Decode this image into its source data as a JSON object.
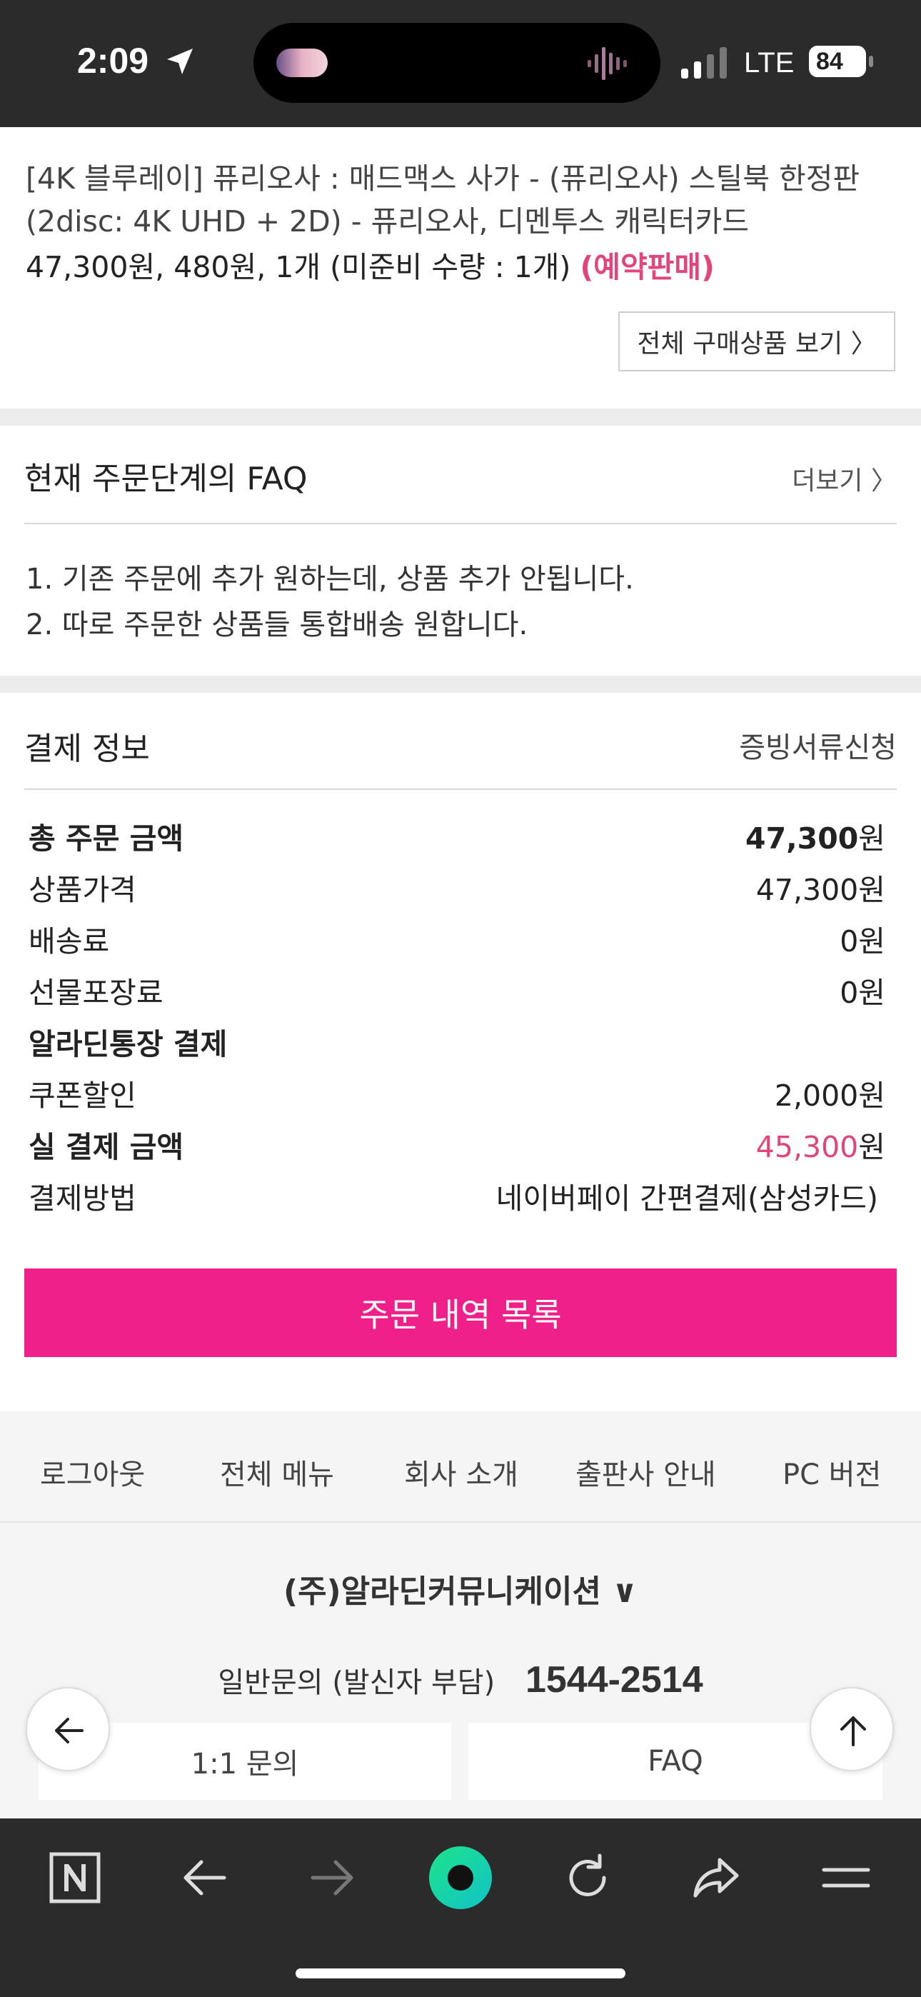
{
  "status_bar": {
    "time": "2:09",
    "network": "LTE",
    "battery": "84"
  },
  "product": {
    "title": "[4K 블루레이] 퓨리오사 : 매드맥스 사가 - (퓨리오사) 스틸북 한정판 (2disc: 4K UHD + 2D) - 퓨리오사, 디멘투스 캐릭터카드",
    "price_line": "47,300원, 480원, 1개 (미준비 수량 : 1개)",
    "preorder": "(예약판매)",
    "view_all_button": "전체 구매상품 보기 〉"
  },
  "faq": {
    "heading": "현재 주문단계의 FAQ",
    "more": "더보기 〉",
    "items": [
      "1. 기존 주문에 추가 원하는데, 상품 추가 안됩니다.",
      "2. 따로 주문한 상품들 통합배송 원합니다."
    ]
  },
  "payment": {
    "heading": "결제 정보",
    "certificate_link": "증빙서류신청",
    "rows": [
      {
        "label": "총 주문 금액",
        "value_num": "47,300",
        "value_unit": "원"
      },
      {
        "label": "상품가격",
        "value": "47,300원"
      },
      {
        "label": "배송료",
        "value": "0원"
      },
      {
        "label": "선물포장료",
        "value": "0원"
      },
      {
        "label": "알라딘통장 결제",
        "value": ""
      },
      {
        "label": "쿠폰할인",
        "value": "2,000원"
      },
      {
        "label": "실 결제 금액",
        "value_num": "45,300",
        "value_unit": "원"
      },
      {
        "label": "결제방법",
        "value": "네이버페이 간편결제(삼성카드)"
      }
    ],
    "order_list_button": "주문 내역 목록"
  },
  "footer": {
    "nav": [
      "로그아웃",
      "전체 메뉴",
      "회사 소개",
      "출판사 안내",
      "PC 버전"
    ],
    "company": "(주)알라딘커뮤니케이션 ∨",
    "inquiry_label": "일반문의 (발신자 부담)",
    "inquiry_number": "1544-2514",
    "buttons": [
      "1:1 문의",
      "FAQ"
    ]
  },
  "colors": {
    "accent_pink": "#f0208a",
    "highlight_red": "#e0457b",
    "status_bar": "#2b2b2b"
  },
  "icons": {
    "status": [
      "location-arrow-icon",
      "signal-icon",
      "battery-icon"
    ],
    "browser": [
      "naver-n-icon",
      "back-icon",
      "forward-icon",
      "green-dot-icon",
      "reload-icon",
      "share-icon",
      "menu-icon"
    ],
    "floating": [
      "back-arrow-icon",
      "scroll-top-icon"
    ]
  }
}
